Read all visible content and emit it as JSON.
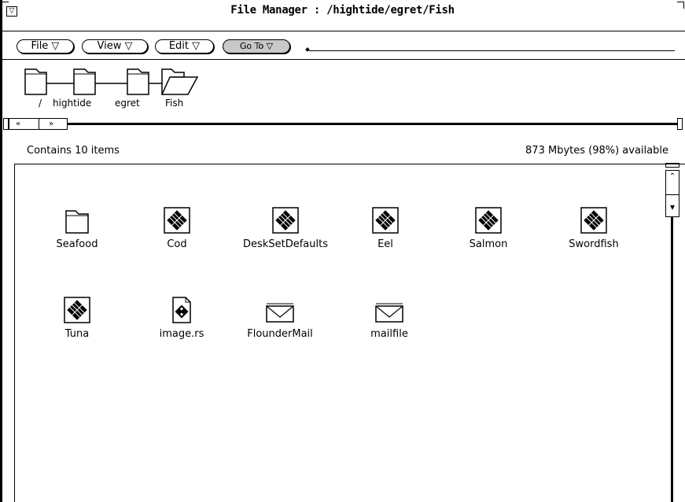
{
  "window": {
    "title": "File Manager : /hightide/egret/Fish",
    "menu_glyph": "▽"
  },
  "menubar": {
    "file": "File ▽",
    "view": "View ▽",
    "edit": "Edit ▽",
    "goto": "Go To ▽"
  },
  "path": {
    "segments": [
      "/",
      "hightide",
      "egret",
      "Fish"
    ]
  },
  "status": {
    "item_count": "Contains 10 items",
    "space": "873 Mbytes (98%) available"
  },
  "scroll_glyphs": {
    "left": "«",
    "right": "»",
    "up": "⌃",
    "down": "▾"
  },
  "items": [
    {
      "name": "Seafood",
      "icon": "folder-icon"
    },
    {
      "name": "Cod",
      "icon": "document-icon"
    },
    {
      "name": "DeskSetDefaults",
      "icon": "document-icon"
    },
    {
      "name": "Eel",
      "icon": "document-icon"
    },
    {
      "name": "Salmon",
      "icon": "document-icon"
    },
    {
      "name": "Swordfish",
      "icon": "document-icon"
    },
    {
      "name": "Tuna",
      "icon": "document-icon"
    },
    {
      "name": "image.rs",
      "icon": "image-file-icon"
    },
    {
      "name": "FlounderMail",
      "icon": "mail-icon"
    },
    {
      "name": "mailfile",
      "icon": "mail-icon"
    }
  ]
}
